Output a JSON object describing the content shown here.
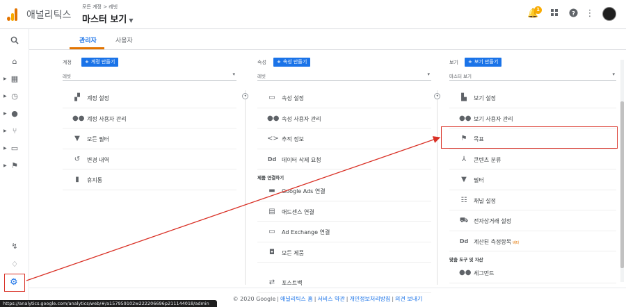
{
  "header": {
    "app_name": "애널리틱스",
    "breadcrumb": "모든 계정 > 레빗",
    "view_title": "마스터 보기",
    "notification_count": "1"
  },
  "tabs": [
    {
      "label": "관리자",
      "active": true
    },
    {
      "label": "사용자",
      "active": false
    }
  ],
  "account": {
    "label": "계정",
    "create_button": "계정 만들기",
    "selected": "레빗",
    "items": [
      {
        "label": "계정 설정",
        "icon": "building-icon"
      },
      {
        "label": "계정 사용자 관리",
        "icon": "users-icon"
      },
      {
        "label": "모든 필터",
        "icon": "filter-icon"
      },
      {
        "label": "변경 내역",
        "icon": "history-icon"
      },
      {
        "label": "휴지통",
        "icon": "trash-icon"
      }
    ]
  },
  "property": {
    "label": "속성",
    "create_button": "속성 만들기",
    "selected": "레빗",
    "items": [
      {
        "label": "속성 설정",
        "icon": "window-icon"
      },
      {
        "label": "속성 사용자 관리",
        "icon": "users-icon"
      },
      {
        "label": "추적 정보",
        "icon": "code-icon"
      },
      {
        "label": "데이터 삭제 요청",
        "icon": "dd-icon"
      }
    ],
    "linking_section": "제품 연결하기",
    "linking_items": [
      {
        "label": "Google Ads 연결",
        "icon": "ads-icon"
      },
      {
        "label": "애드센스 연결",
        "icon": "adsense-icon"
      },
      {
        "label": "Ad Exchange 연결",
        "icon": "window-icon"
      },
      {
        "label": "모든 제품",
        "icon": "products-icon"
      }
    ],
    "postback": {
      "label": "포스트백",
      "icon": "postback-icon"
    }
  },
  "view": {
    "label": "보기",
    "create_button": "보기 만들기",
    "selected": "마스터 보기",
    "items": [
      {
        "label": "보기 설정",
        "icon": "doc-icon"
      },
      {
        "label": "보기 사용자 관리",
        "icon": "users-icon"
      },
      {
        "label": "목표",
        "icon": "flag-icon"
      },
      {
        "label": "콘텐츠 분류",
        "icon": "grouping-icon"
      },
      {
        "label": "필터",
        "icon": "filter-icon"
      },
      {
        "label": "채널 설정",
        "icon": "channel-icon"
      },
      {
        "label": "전자상거래 설정",
        "icon": "cart-icon"
      },
      {
        "label": "계산된 측정항목",
        "icon": "dd-icon",
        "beta": "베타"
      }
    ],
    "tools_section": "맞춤 도구 및 자산",
    "tools_items": [
      {
        "label": "세그먼트",
        "icon": "segment-icon"
      }
    ]
  },
  "footer": {
    "copyright": "© 2020 Google",
    "links": [
      "애널리틱스 홈",
      "서비스 약관",
      "개인정보처리방침",
      "의견 보내기"
    ]
  },
  "status_url": "https://analytics.google.com/analytics/web/#/a157959102w222206696p211144018/admin",
  "colors": {
    "accent_blue": "#1a73e8",
    "tab_orange": "#e37400",
    "highlight_red": "#d93025"
  }
}
